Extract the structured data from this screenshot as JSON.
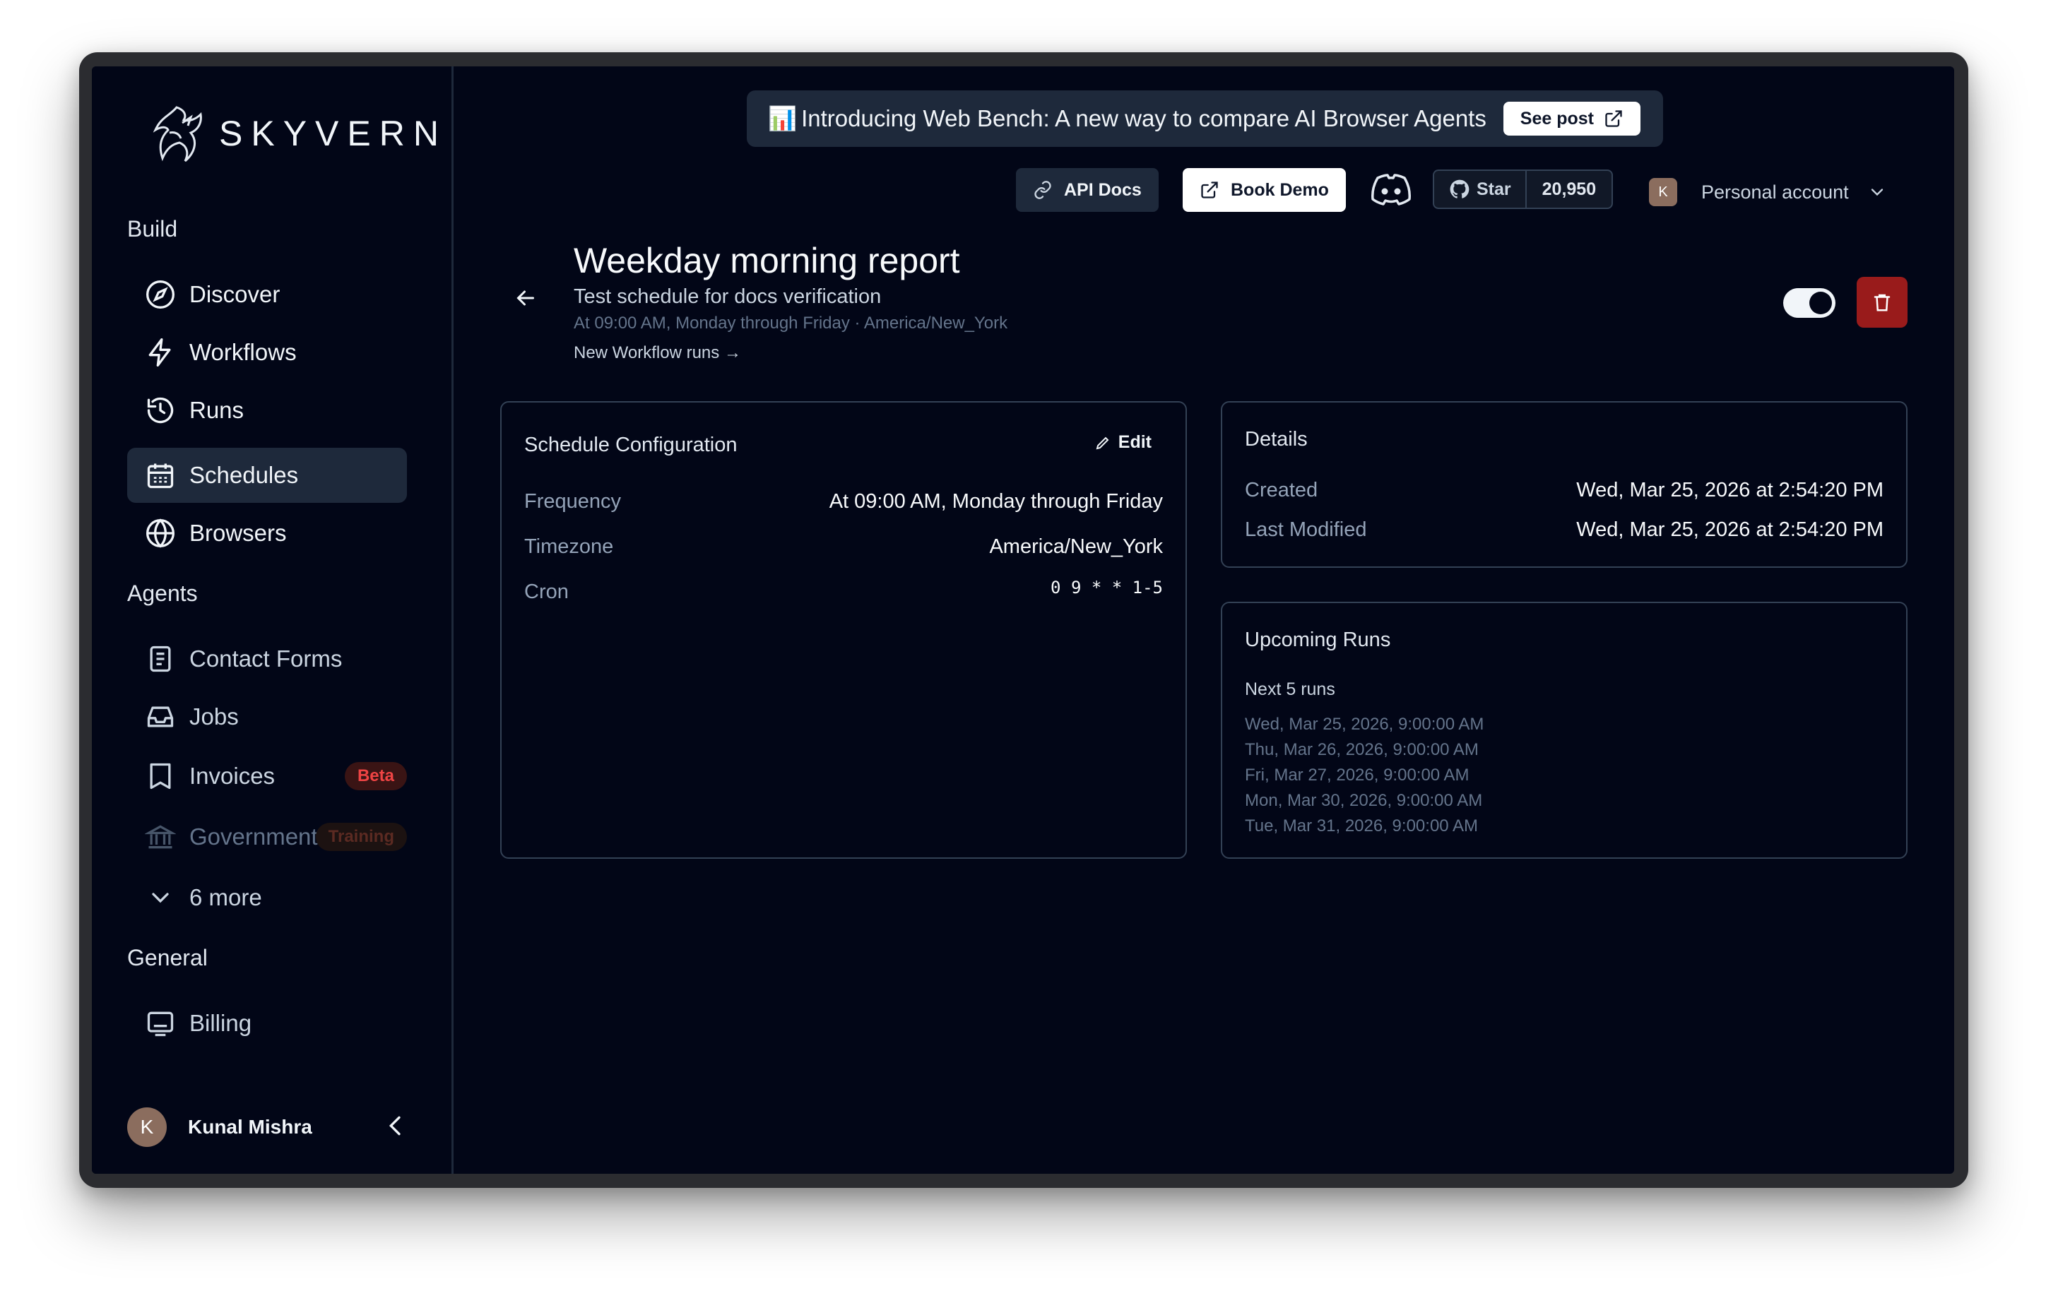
{
  "brand": {
    "name": "SKYVERN"
  },
  "sidebar": {
    "sections": {
      "build": "Build",
      "agents": "Agents",
      "general": "General"
    },
    "build_items": [
      {
        "label": "Discover",
        "icon": "compass-icon"
      },
      {
        "label": "Workflows",
        "icon": "lightning-icon"
      },
      {
        "label": "Runs",
        "icon": "history-icon"
      },
      {
        "label": "Schedules",
        "icon": "calendar-icon",
        "active": true
      },
      {
        "label": "Browsers",
        "icon": "globe-icon"
      }
    ],
    "agent_items": [
      {
        "label": "Contact Forms",
        "icon": "document-icon"
      },
      {
        "label": "Jobs",
        "icon": "inbox-icon"
      },
      {
        "label": "Invoices",
        "icon": "bookmark-icon",
        "badge": "Beta"
      },
      {
        "label": "Government",
        "icon": "bank-icon",
        "badge": "Training"
      },
      {
        "label": "6 more",
        "icon": "chevron-down-icon"
      }
    ],
    "general_items": [
      {
        "label": "Billing",
        "icon": "billing-icon"
      }
    ],
    "user": {
      "initial": "K",
      "name": "Kunal Mishra"
    }
  },
  "banner": {
    "emoji": "📊",
    "text": "Introducing Web Bench: A new way to compare AI Browser Agents",
    "button": "See post"
  },
  "header": {
    "api_docs": "API Docs",
    "book_demo": "Book Demo",
    "github_star": "Star",
    "github_count": "20,950",
    "account_initial": "K",
    "account_label": "Personal account"
  },
  "schedule": {
    "title": "Weekday morning report",
    "description": "Test schedule for docs verification",
    "subtitle": "At 09:00 AM, Monday through Friday · America/New_York",
    "runs_link": "New Workflow runs →",
    "enabled": true
  },
  "config_card": {
    "title": "Schedule Configuration",
    "edit": "Edit",
    "rows": [
      {
        "label": "Frequency",
        "value": "At 09:00 AM, Monday through Friday"
      },
      {
        "label": "Timezone",
        "value": "America/New_York"
      },
      {
        "label": "Cron",
        "value": "0 9 * * 1-5"
      }
    ]
  },
  "details_card": {
    "title": "Details",
    "rows": [
      {
        "label": "Created",
        "value": "Wed, Mar 25, 2026 at 2:54:20 PM"
      },
      {
        "label": "Last Modified",
        "value": "Wed, Mar 25, 2026 at 2:54:20 PM"
      }
    ]
  },
  "upcoming_card": {
    "title": "Upcoming Runs",
    "subtitle": "Next 5 runs",
    "runs": [
      "Wed, Mar 25, 2026, 9:00:00 AM",
      "Thu, Mar 26, 2026, 9:00:00 AM",
      "Fri, Mar 27, 2026, 9:00:00 AM",
      "Mon, Mar 30, 2026, 9:00:00 AM",
      "Tue, Mar 31, 2026, 9:00:00 AM"
    ]
  },
  "colors": {
    "background": "#020617",
    "panel": "#1e293b",
    "border": "#334155",
    "danger": "#991b1b",
    "beta_text": "#ef4444"
  }
}
